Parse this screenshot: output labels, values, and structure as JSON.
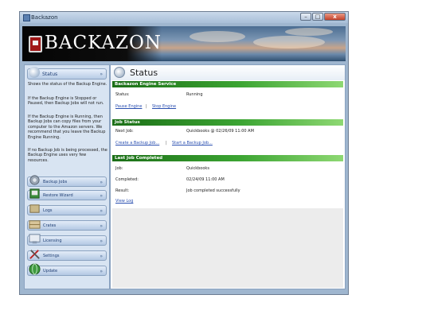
{
  "window": {
    "title": "Backazon",
    "min_glyph": "–",
    "max_glyph": "□",
    "close_glyph": "x"
  },
  "banner": {
    "logo_text": "BACKAZON",
    "logo_icon": "backazon-logo-icon"
  },
  "sidebar": {
    "header": {
      "label": "Status",
      "icon": "status-icon"
    },
    "description": [
      "Shows the status of the Backup Engine.",
      "If the Backup Engine is Stopped or Paused, then Backup Jobs will not run.",
      "If the Backup Engine is Running, then Backup Jobs can copy files from your computer to the Amazon servers.  We recommend that you leave the Backup Engine Running.",
      "If no Backup Job is being processed, the Backup Engine uses very few resources."
    ],
    "items": [
      {
        "label": "Backup Jobs",
        "icon": "gear-icon"
      },
      {
        "label": "Restore Wizard",
        "icon": "restore-icon"
      },
      {
        "label": "Logs",
        "icon": "log-icon"
      },
      {
        "label": "Crates",
        "icon": "crate-icon"
      },
      {
        "label": "Licensing",
        "icon": "license-icon"
      },
      {
        "label": "Settings",
        "icon": "settings-icon"
      },
      {
        "label": "Update",
        "icon": "globe-icon"
      }
    ]
  },
  "main": {
    "title": "Status",
    "engine": {
      "heading": "Backazon Engine Service",
      "status_label": "Status:",
      "status_value": "Running",
      "pause_link": "Pause Engine",
      "stop_link": "Stop Engine",
      "separator": "|"
    },
    "job": {
      "heading": "Job Status",
      "next_label": "Next Job:",
      "next_value": "Quickbooks @ 02/26/09 11:00 AM",
      "create_link": "Create a Backup Job...",
      "start_link": "Start a Backup Job...",
      "separator": "|"
    },
    "last": {
      "heading": "Last Job Completed",
      "job_label": "Job:",
      "job_value": "Quickbooks",
      "completed_label": "Completed:",
      "completed_value": "02/24/09 11:00 AM",
      "result_label": "Result:",
      "result_value": "Job completed successfully",
      "log_link": "View Log"
    }
  },
  "colors": {
    "section_bar": "#3ba432",
    "link": "#2a4fb0",
    "sidebar_bg": "#d8e4f2",
    "frame": "#9fb6cf"
  }
}
